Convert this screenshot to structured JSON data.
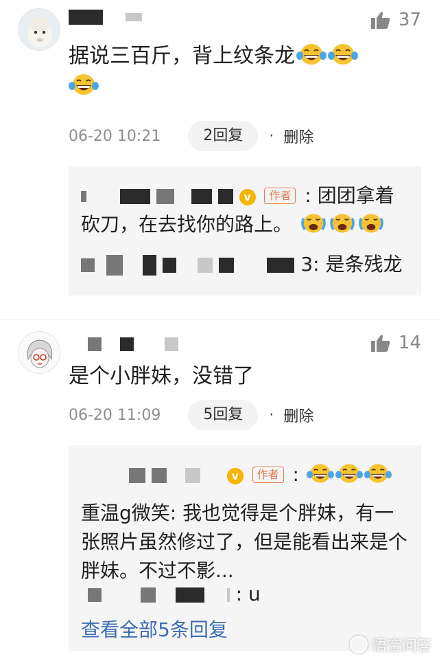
{
  "comments": [
    {
      "likes": "37",
      "text": "据说三百斤，背上纹条龙",
      "emoji_count": 3,
      "time": "06-20 10:21",
      "reply_count": "2回复",
      "delete_label": "删除",
      "replies": [
        {
          "author_badge": "作者",
          "text": ": 团团拿着砍刀，在去找你的路上。"
        },
        {
          "suffix": "3",
          "text": ": 是条残龙"
        }
      ]
    },
    {
      "likes": "14",
      "text": "是个小胖妹，没错了",
      "time": "06-20 11:09",
      "reply_count": "5回复",
      "delete_label": "删除",
      "replies": [
        {
          "author_badge": "作者",
          "text": ":"
        },
        {
          "text": "重温g微笑: 我也觉得是个胖妹，有一张照片虽然修过了，但是能看出来是个胖妹。不过不影..."
        },
        {
          "suffix": ": u",
          "text": ""
        }
      ],
      "view_all": "查看全部5条回复"
    }
  ],
  "watermark": "悟空问答",
  "colors": {
    "accent_link": "#3d6db3",
    "author_badge": "#e07a4d",
    "verified": "#f5b400"
  },
  "icons": [
    "thumbs-up-icon",
    "laughing-tears-emoji",
    "crying-laugh-emoji",
    "verified-badge-icon"
  ]
}
